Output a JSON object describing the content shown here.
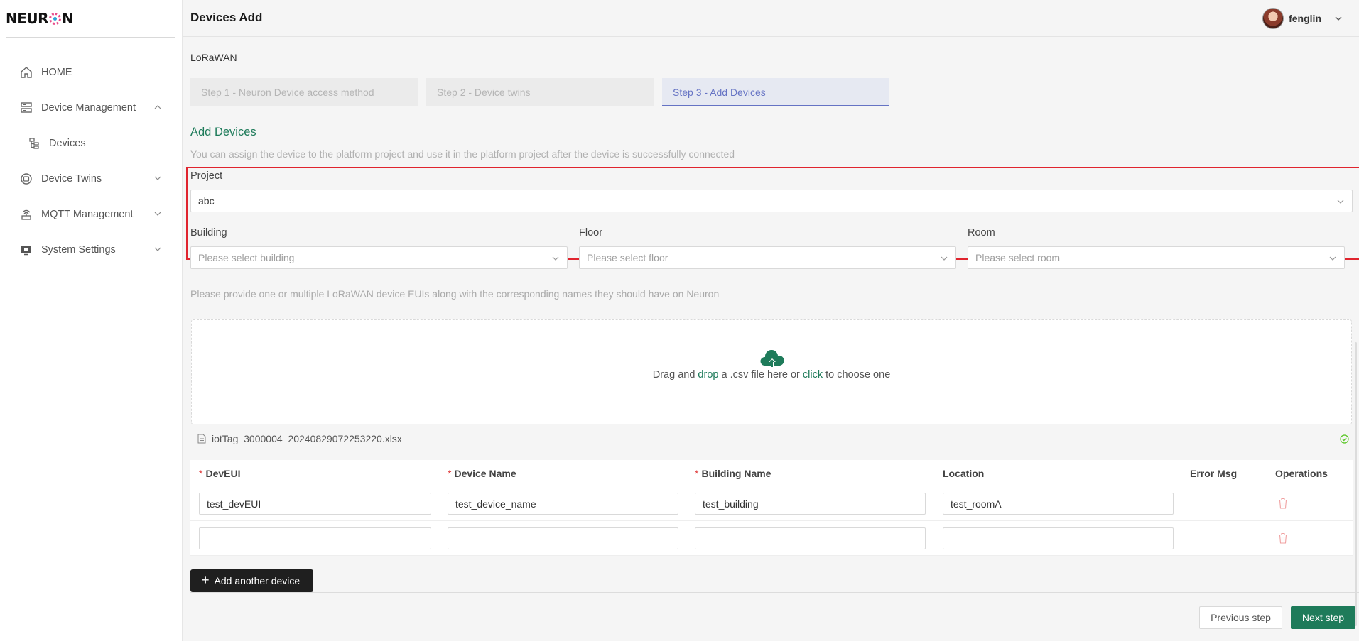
{
  "app": {
    "logo_text_left": "NEUR",
    "logo_text_right": "N"
  },
  "sidebar": {
    "items": [
      {
        "label": "HOME",
        "icon": "home-icon"
      },
      {
        "label": "Device Management",
        "icon": "server-icon",
        "expanded": true
      },
      {
        "label": "Devices",
        "icon": "device-tree-icon",
        "sub": true
      },
      {
        "label": "Device Twins",
        "icon": "twin-icon"
      },
      {
        "label": "MQTT Management",
        "icon": "broadcast-icon"
      },
      {
        "label": "System Settings",
        "icon": "monitor-icon"
      }
    ]
  },
  "header": {
    "title": "Devices Add",
    "user": "fenglin"
  },
  "main": {
    "protocol": "LoRaWAN",
    "steps": [
      {
        "label": "Step 1 - Neuron Device access method",
        "active": false
      },
      {
        "label": "Step 2 - Device twins",
        "active": false
      },
      {
        "label": "Step 3 - Add Devices",
        "active": true
      }
    ],
    "section_title": "Add Devices",
    "section_desc": "You can assign the device to the platform project and use it in the platform project after the device is successfully connected",
    "project": {
      "label": "Project",
      "value": "abc"
    },
    "building": {
      "label": "Building",
      "placeholder": "Please select building"
    },
    "floor": {
      "label": "Floor",
      "placeholder": "Please select floor"
    },
    "room": {
      "label": "Room",
      "placeholder": "Please select room"
    },
    "hint": "Please provide one or multiple LoRaWAN device EUIs along with the corresponding names they should have on Neuron",
    "dropzone": {
      "text_1": "Drag and ",
      "link_drop": "drop",
      "text_2": " a .csv file here or ",
      "link_click": "click",
      "text_3": " to choose one"
    },
    "file_name": "iotTag_3000004_20240829072253220.xlsx",
    "table": {
      "headers": {
        "deveui": "DevEUI",
        "device_name": "Device Name",
        "building_name": "Building Name",
        "location": "Location",
        "error_msg": "Error Msg",
        "operations": "Operations"
      },
      "rows": [
        {
          "deveui": "test_devEUI",
          "device_name": "test_device_name",
          "building_name": "test_building",
          "location": "test_roomA"
        },
        {
          "deveui": "",
          "device_name": "",
          "building_name": "",
          "location": ""
        }
      ]
    },
    "add_button": "Add another device",
    "prev_button": "Previous step",
    "next_button": "Next step"
  },
  "colors": {
    "accent": "#1e7b5a",
    "step_active": "#6573c4",
    "highlight_box": "#e0242e",
    "danger": "#e03a3a"
  }
}
